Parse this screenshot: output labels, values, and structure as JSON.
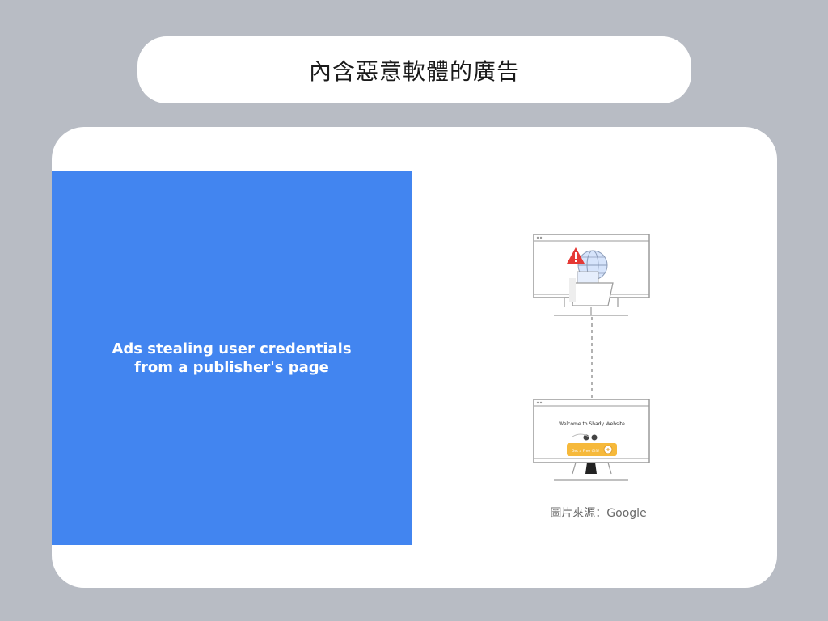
{
  "header": {
    "title": "內含惡意軟體的廣告"
  },
  "panel": {
    "line1": "Ads stealing user credentials",
    "line2": "from a publisher's page"
  },
  "illustration": {
    "screen_text": "Welcome to Shady Website",
    "button_text": "Get a Free Gift!",
    "warning_color": "#e53935",
    "button_color": "#f6b93b"
  },
  "credit": {
    "text": "圖片來源：Google"
  }
}
